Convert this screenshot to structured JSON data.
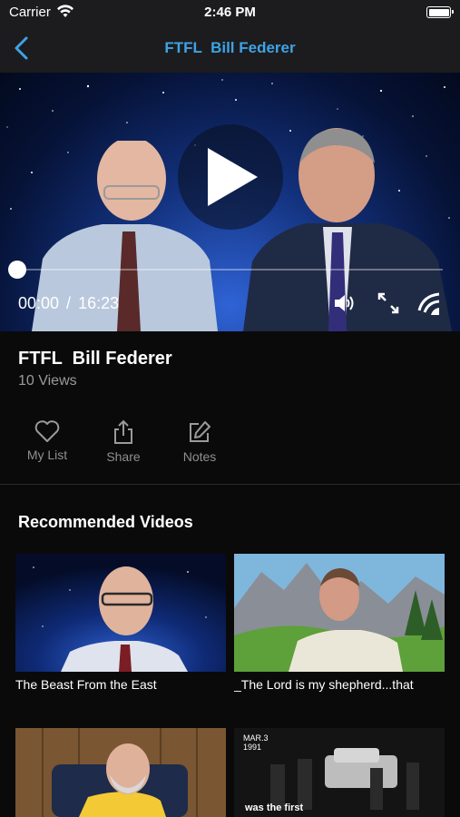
{
  "status_bar": {
    "carrier": "Carrier",
    "time": "2:46 PM"
  },
  "nav": {
    "title": "FTFL  Bill Federer",
    "back_icon": "chevron-left-icon"
  },
  "player": {
    "current_time": "00:00",
    "separator": "/",
    "duration": "16:23",
    "progress": 0,
    "icons": [
      "play-icon",
      "volume-icon",
      "fullscreen-icon",
      "cast-icon"
    ]
  },
  "video": {
    "title": "FTFL  Bill Federer",
    "views": "10 Views"
  },
  "actions": [
    {
      "label": "My List",
      "icon": "heart-icon"
    },
    {
      "label": "Share",
      "icon": "share-icon"
    },
    {
      "label": "Notes",
      "icon": "edit-icon"
    }
  ],
  "recommended": {
    "heading": "Recommended Videos",
    "items": [
      {
        "title": "The Beast From the East"
      },
      {
        "title": "_The Lord is my shepherd...that"
      },
      {
        "title": ""
      },
      {
        "title": "",
        "overlay_date": "MAR.3\n1991",
        "overlay_caption": "was the first"
      }
    ]
  },
  "colors": {
    "accent": "#3ea3e6",
    "background": "#0a0a0a",
    "bar": "#1c1c1e"
  }
}
